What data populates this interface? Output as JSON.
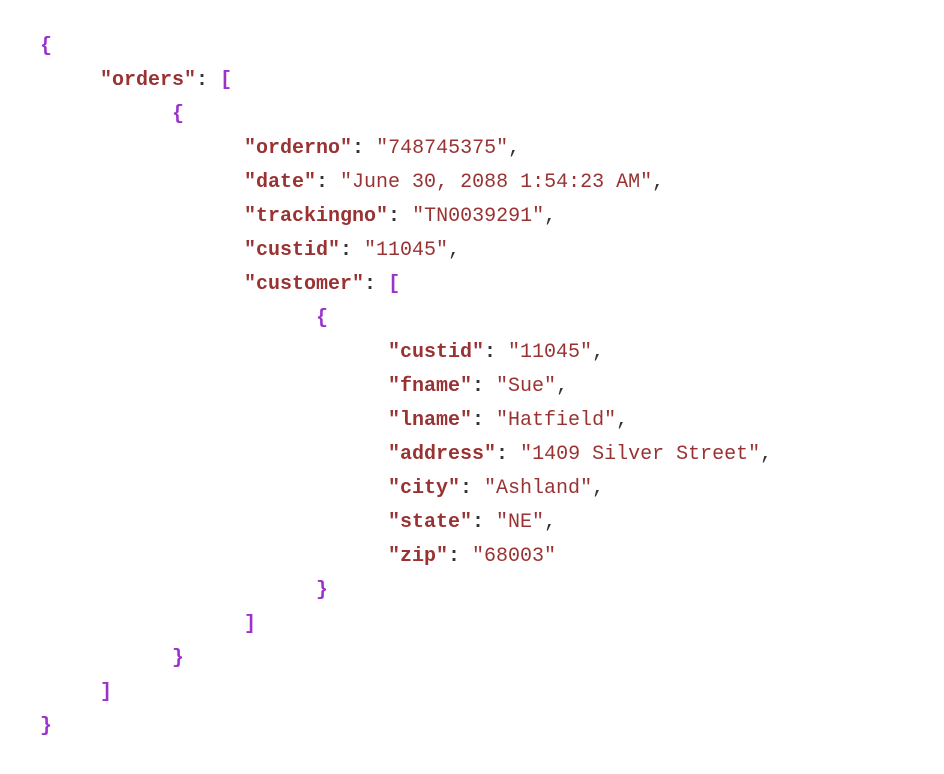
{
  "code": {
    "keys": {
      "orders": "\"orders\"",
      "orderno": "\"orderno\"",
      "date": "\"date\"",
      "trackingno": "\"trackingno\"",
      "custid": "\"custid\"",
      "customer": "\"customer\"",
      "fname": "\"fname\"",
      "lname": "\"lname\"",
      "address": "\"address\"",
      "city": "\"city\"",
      "state": "\"state\"",
      "zip": "\"zip\""
    },
    "values": {
      "orderno": "\"748745375\"",
      "date": "\"June 30, 2088 1:54:23 AM\"",
      "trackingno": "\"TN0039291\"",
      "custid_outer": "\"11045\"",
      "custid_inner": "\"11045\"",
      "fname": "\"Sue\"",
      "lname": "\"Hatfield\"",
      "address": "\"1409 Silver Street\"",
      "city": "\"Ashland\"",
      "state": "\"NE\"",
      "zip": "\"68003\""
    },
    "punct": {
      "open_brace": "{",
      "close_brace": "}",
      "open_bracket": "[",
      "close_bracket": "]",
      "colon": ":",
      "comma": ","
    }
  }
}
